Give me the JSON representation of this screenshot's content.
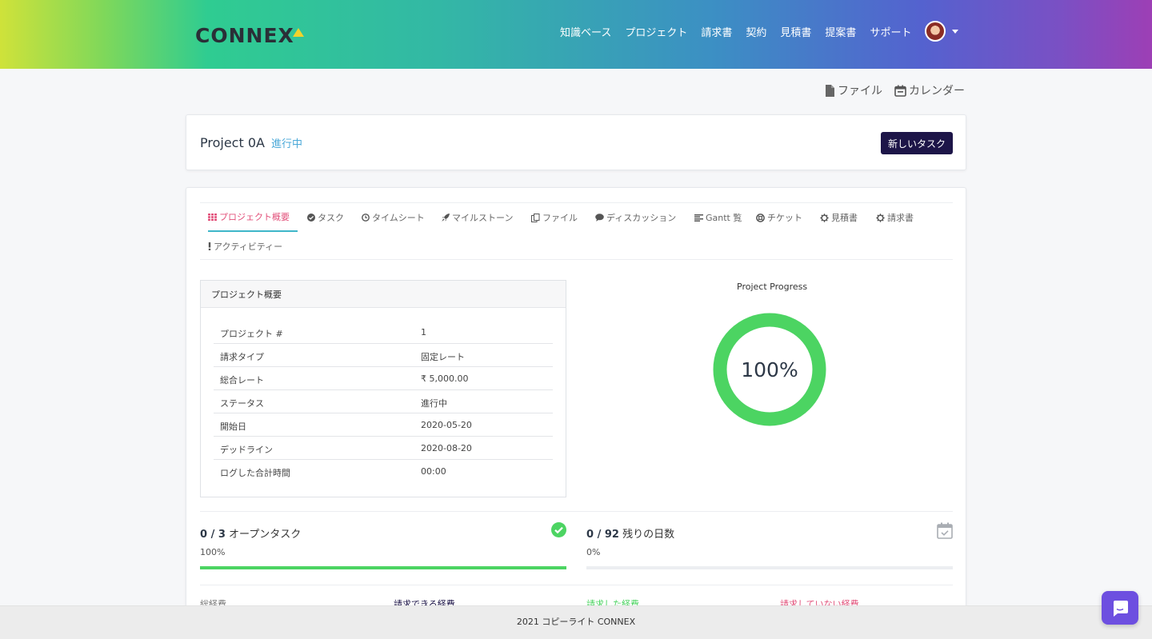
{
  "brand": {
    "name": "CONNEX"
  },
  "nav": {
    "items": [
      "知識ベース",
      "プロジェクト",
      "請求書",
      "契約",
      "見積書",
      "提案書",
      "サポート"
    ]
  },
  "quick_links": {
    "files": "ファイル",
    "calendar": "カレンダー"
  },
  "project": {
    "name": "Project 0A",
    "status": "進行中",
    "new_task_label": "新しいタスク"
  },
  "tabs": [
    {
      "label": "プロジェクト概要",
      "icon": "grid-icon",
      "active": true
    },
    {
      "label": "タスク",
      "icon": "check-circle-icon"
    },
    {
      "label": "タイムシート",
      "icon": "clock-icon"
    },
    {
      "label": "マイルストーン",
      "icon": "rocket-icon"
    },
    {
      "label": "ファイル",
      "icon": "files-icon"
    },
    {
      "label": "ディスカッション",
      "icon": "comment-icon"
    },
    {
      "label": "Gantt 覧",
      "icon": "align-left-icon"
    },
    {
      "label": "チケット",
      "icon": "life-ring-icon"
    },
    {
      "label": "見積書",
      "icon": "cog-icon"
    },
    {
      "label": "請求書",
      "icon": "cog-icon"
    },
    {
      "label": "アクティビティー",
      "icon": "exclamation-icon"
    }
  ],
  "overview": {
    "title": "プロジェクト概要",
    "rows": [
      {
        "key": "プロジェクト #",
        "value": "1"
      },
      {
        "key": "請求タイプ",
        "value": "固定レート"
      },
      {
        "key": "総合レート",
        "value": "₹ 5,000.00"
      },
      {
        "key": "ステータス",
        "value": "進行中"
      },
      {
        "key": "開始日",
        "value": "2020-05-20"
      },
      {
        "key": "デッドライン",
        "value": "2020-08-20"
      },
      {
        "key": "ログした合計時間",
        "value": "00:00"
      }
    ]
  },
  "progress": {
    "title": "Project Progress",
    "label": "100%",
    "value": 1.0,
    "color": "#4cd462"
  },
  "stats": {
    "tasks": {
      "count": "0 / 3",
      "label": "オープンタスク",
      "percent_label": "100%",
      "fill": 1.0
    },
    "days": {
      "count": "0 / 92",
      "label": "残りの日数",
      "percent_label": "0%",
      "fill": 0.0
    }
  },
  "finance": {
    "total": "総経費",
    "billable": "請求できる経費",
    "billed": "請求した経費",
    "unbilled": "請求していない経費"
  },
  "footer": {
    "text": "2021 コピーライト CONNEX"
  }
}
